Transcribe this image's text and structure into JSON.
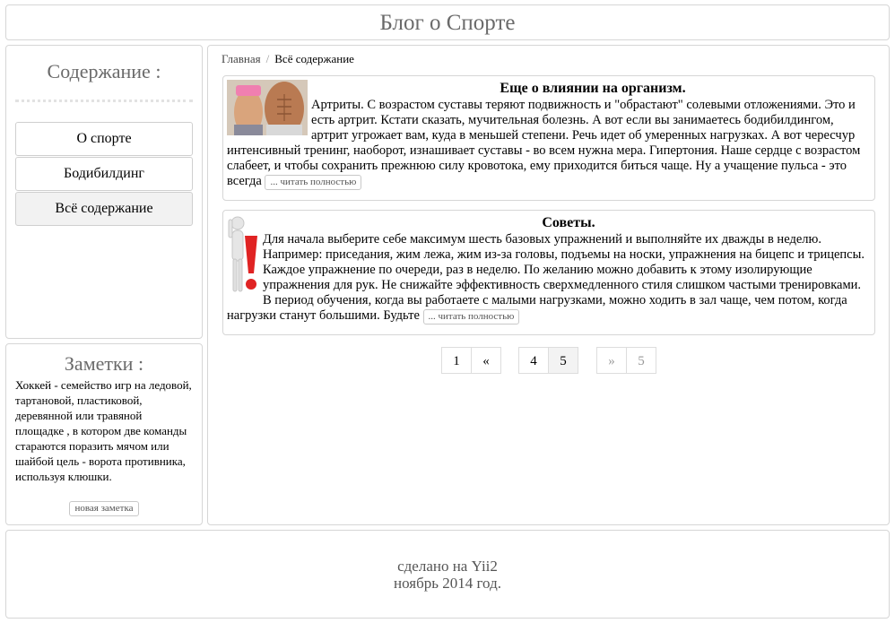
{
  "header": {
    "title": "Блог о Спорте"
  },
  "sidebar": {
    "heading": "Содержание :",
    "menu": [
      {
        "label": "О спорте"
      },
      {
        "label": "Бодибилдинг"
      },
      {
        "label": "Всё содержание"
      }
    ]
  },
  "notes": {
    "heading": "Заметки :",
    "text": "Хоккей - семейство игр на ледовой, тартановой, пластиковой, деревянной или травяной площадке , в котором две команды стараются поразить мячом или шайбой цель - ворота противника, используя клюшки.",
    "new_note_label": "новая заметка"
  },
  "breadcrumb": {
    "home": "Главная",
    "separator": "/",
    "current": "Всё содержание"
  },
  "articles": [
    {
      "title": "Еще о влиянии на организм.",
      "text": "Артриты. С возрастом суставы теряют подвижность и \"обрастают\" солевыми отложениями. Это и есть артрит. Кстати сказать, мучительная болезнь. А вот если вы занимаетесь бодибилдингом, артрит угрожает вам, куда в меньшей степени. Речь идет об умеренных нагрузках. А вот чересчур интенсивный тренинг, наоборот, изнашивает суставы - во всем нужна мера. Гипертония. Наше сердце с возрастом слабеет, и чтобы сохранить прежнюю силу кровотока, ему приходится биться чаще. Ну а учащение пульса - это всегда",
      "read_more": "... читать полностью"
    },
    {
      "title": "Советы.",
      "text": "Для начала выберите себе максимум шесть базовых упражнений и выполняйте их дважды в неделю. Например: приседания, жим лежа, жим из-за головы, подъемы на носки, упражнения на бицепс и трицепсы. Каждое упражнение по очереди, раз в неделю. По желанию можно добавить к этому изолирующие упражнения для рук. Не снижайте эффективность сверхмедленного стиля слишком частыми тренировками. В период обучения, когда вы работаете с малыми нагрузками, можно ходить в зал чаще, чем потом, когда нагрузки станут большими. Будьте",
      "read_more": "... читать полностью"
    }
  ],
  "pagination": {
    "first": "1",
    "prev": "«",
    "pages": [
      "4",
      "5"
    ],
    "next": "»",
    "last": "5",
    "active": "5"
  },
  "footer": {
    "line1": "сделано на Yii2",
    "line2": "ноябрь 2014 год."
  }
}
